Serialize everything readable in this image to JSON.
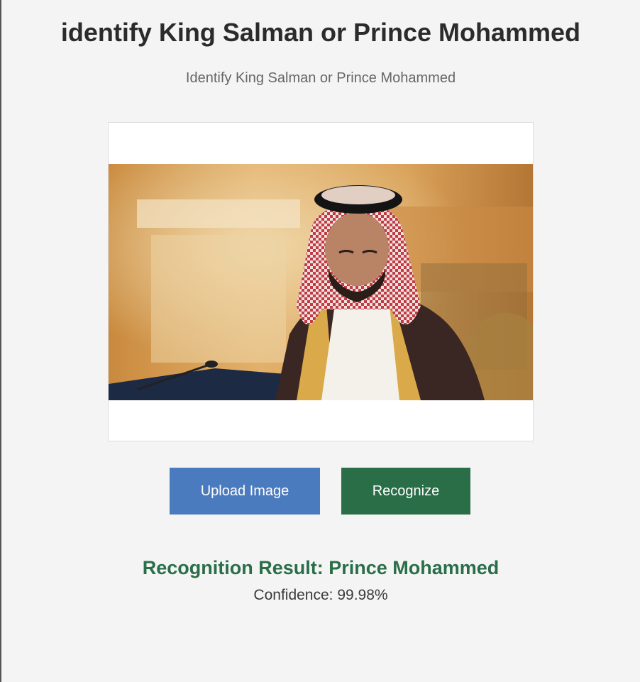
{
  "header": {
    "title": "identify King Salman or Prince Mohammed",
    "subtitle": "Identify King Salman or Prince Mohammed"
  },
  "preview": {
    "image_alt": "uploaded-photo"
  },
  "actions": {
    "upload_label": "Upload Image",
    "recognize_label": "Recognize"
  },
  "result": {
    "label": "Recognition Result: Prince Mohammed",
    "confidence": "Confidence: 99.98%"
  },
  "colors": {
    "background": "#f4f4f4",
    "upload_button": "#4b7bbf",
    "recognize_button": "#2a6e48",
    "result_text": "#2a6e48"
  }
}
